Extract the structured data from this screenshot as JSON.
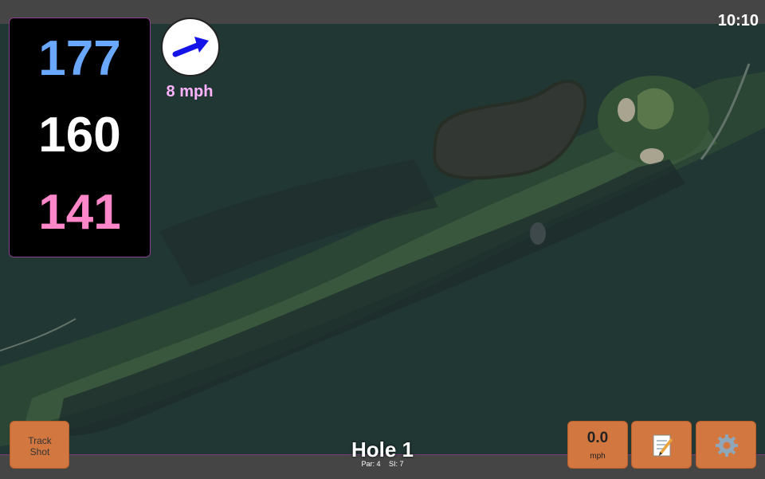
{
  "clock": {
    "time": "10:10"
  },
  "yardage": {
    "back": "177",
    "middle": "160",
    "front": "141"
  },
  "wind": {
    "speed": "8 mph",
    "icon": "wind-direction-arrow-icon"
  },
  "buttons": {
    "track_shot": "Track Shot",
    "speed_value": "0.0",
    "speed_unit": "mph",
    "notes_icon": "notepad-icon",
    "settings_icon": "gear-icon"
  },
  "hole": {
    "title": "Hole 1",
    "par": "Par: 4",
    "si": "SI: 7"
  },
  "colors": {
    "back_yardage": "#6aa8ff",
    "middle_yardage": "#ffffff",
    "front_yardage": "#ff86c8",
    "button": "#d2773f",
    "bar": "#454545"
  }
}
